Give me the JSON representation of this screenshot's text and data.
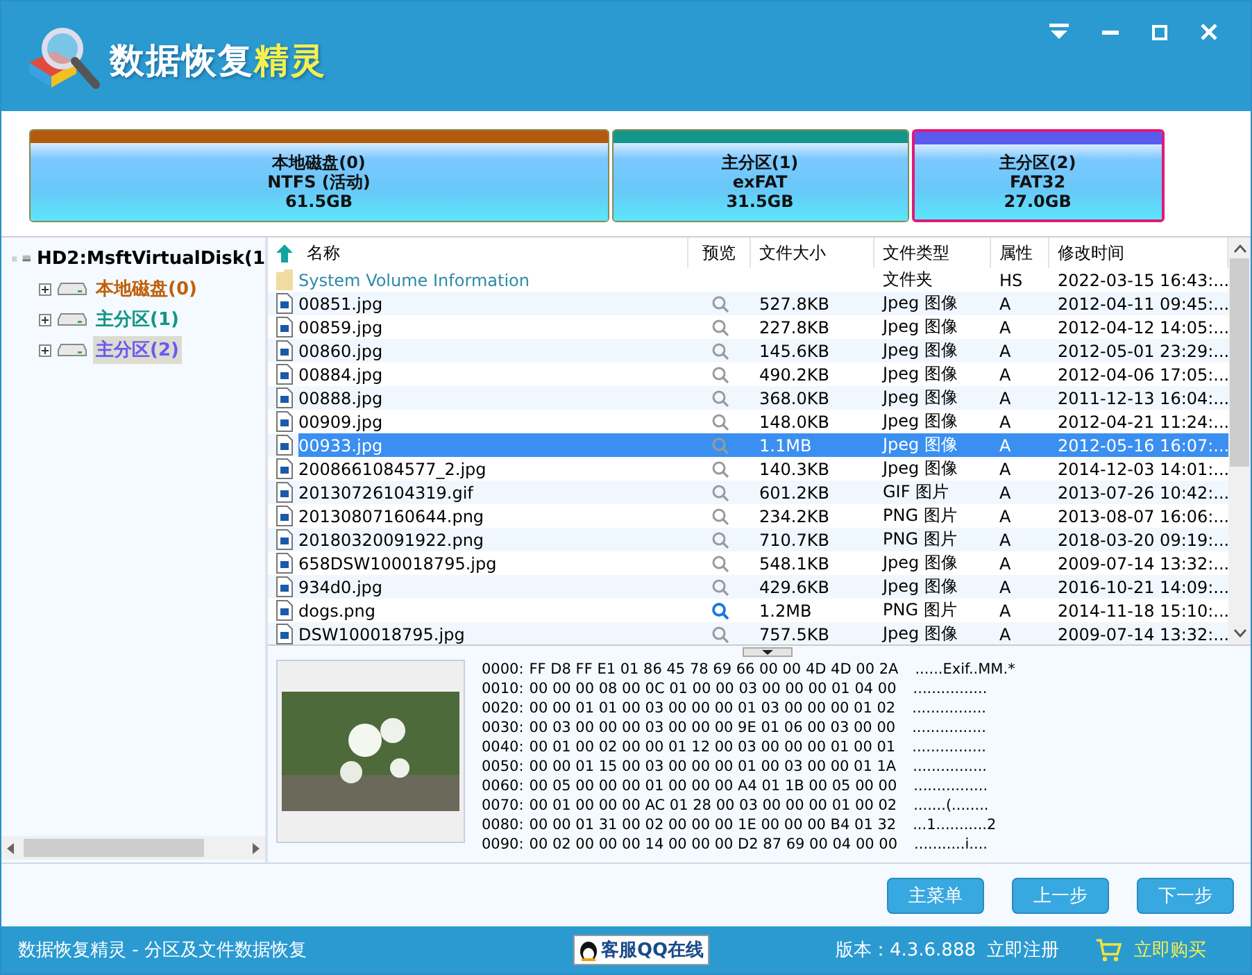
{
  "logo": {
    "text": "数据恢复",
    "accent": "精灵"
  },
  "partitions": [
    {
      "name": "本地磁盘(0)",
      "fs": "NTFS (活动)",
      "size": "61.5GB",
      "color": "#b35a0e",
      "selected": false
    },
    {
      "name": "主分区(1)",
      "fs": "exFAT",
      "size": "31.5GB",
      "color": "#13958a",
      "selected": false
    },
    {
      "name": "主分区(2)",
      "fs": "FAT32",
      "size": "27.0GB",
      "color": "#5a5af0",
      "selected": true
    }
  ],
  "tree": {
    "label": "HD2:MsftVirtualDisk(1",
    "expanded": true,
    "children": [
      {
        "label": "本地磁盘(0)",
        "color": "#c0600c",
        "expanded": false,
        "selected": false
      },
      {
        "label": "主分区(1)",
        "color": "#13958a",
        "expanded": false,
        "selected": false
      },
      {
        "label": "主分区(2)",
        "color": "#6a5af0",
        "expanded": false,
        "selected": true
      }
    ]
  },
  "table": {
    "columns": [
      "名称",
      "预览",
      "文件大小",
      "文件类型",
      "属性",
      "修改时间"
    ],
    "rows": [
      {
        "kind": "folder",
        "name": "System Volume Information",
        "preview_icon": false,
        "preview_hover": false,
        "size": "",
        "type": "文件夹",
        "attr": "HS",
        "time": "2022-03-15 16:43:...",
        "selected": false
      },
      {
        "kind": "image",
        "name": "00851.jpg",
        "preview_icon": true,
        "preview_hover": false,
        "size": "527.8KB",
        "type": "Jpeg 图像",
        "attr": "A",
        "time": "2012-04-11 09:45:...",
        "selected": false
      },
      {
        "kind": "image",
        "name": "00859.jpg",
        "preview_icon": true,
        "preview_hover": false,
        "size": "227.8KB",
        "type": "Jpeg 图像",
        "attr": "A",
        "time": "2012-04-12 14:05:...",
        "selected": false
      },
      {
        "kind": "image",
        "name": "00860.jpg",
        "preview_icon": true,
        "preview_hover": false,
        "size": "145.6KB",
        "type": "Jpeg 图像",
        "attr": "A",
        "time": "2012-05-01 23:29:...",
        "selected": false
      },
      {
        "kind": "image",
        "name": "00884.jpg",
        "preview_icon": true,
        "preview_hover": false,
        "size": "490.2KB",
        "type": "Jpeg 图像",
        "attr": "A",
        "time": "2012-04-06 17:05:...",
        "selected": false
      },
      {
        "kind": "image",
        "name": "00888.jpg",
        "preview_icon": true,
        "preview_hover": false,
        "size": "368.0KB",
        "type": "Jpeg 图像",
        "attr": "A",
        "time": "2011-12-13 16:04:...",
        "selected": false
      },
      {
        "kind": "image",
        "name": "00909.jpg",
        "preview_icon": true,
        "preview_hover": false,
        "size": "148.0KB",
        "type": "Jpeg 图像",
        "attr": "A",
        "time": "2012-04-21 11:24:...",
        "selected": false
      },
      {
        "kind": "image",
        "name": "00933.jpg",
        "preview_icon": true,
        "preview_hover": false,
        "size": "1.1MB",
        "type": "Jpeg 图像",
        "attr": "A",
        "time": "2012-05-16 16:07:...",
        "selected": true
      },
      {
        "kind": "image",
        "name": "2008661084577_2.jpg",
        "preview_icon": true,
        "preview_hover": false,
        "size": "140.3KB",
        "type": "Jpeg 图像",
        "attr": "A",
        "time": "2014-12-03 14:01:...",
        "selected": false
      },
      {
        "kind": "image",
        "name": "20130726104319.gif",
        "preview_icon": true,
        "preview_hover": false,
        "size": "601.2KB",
        "type": "GIF 图片",
        "attr": "A",
        "time": "2013-07-26 10:42:...",
        "selected": false
      },
      {
        "kind": "image",
        "name": "20130807160644.png",
        "preview_icon": true,
        "preview_hover": false,
        "size": "234.2KB",
        "type": "PNG 图片",
        "attr": "A",
        "time": "2013-08-07 16:06:...",
        "selected": false
      },
      {
        "kind": "image",
        "name": "20180320091922.png",
        "preview_icon": true,
        "preview_hover": false,
        "size": "710.7KB",
        "type": "PNG 图片",
        "attr": "A",
        "time": "2018-03-20 09:19:...",
        "selected": false
      },
      {
        "kind": "image",
        "name": "658DSW100018795.jpg",
        "preview_icon": true,
        "preview_hover": false,
        "size": "548.1KB",
        "type": "Jpeg 图像",
        "attr": "A",
        "time": "2009-07-14 13:32:...",
        "selected": false
      },
      {
        "kind": "image",
        "name": "934d0.jpg",
        "preview_icon": true,
        "preview_hover": false,
        "size": "429.6KB",
        "type": "Jpeg 图像",
        "attr": "A",
        "time": "2016-10-21 14:09:...",
        "selected": false
      },
      {
        "kind": "image",
        "name": "dogs.png",
        "preview_icon": true,
        "preview_hover": true,
        "size": "1.2MB",
        "type": "PNG 图片",
        "attr": "A",
        "time": "2014-11-18 15:10:...",
        "selected": false
      },
      {
        "kind": "image",
        "name": "DSW100018795.jpg",
        "preview_icon": true,
        "preview_hover": false,
        "size": "757.5KB",
        "type": "Jpeg 图像",
        "attr": "A",
        "time": "2009-07-14 13:32:...",
        "selected": false
      }
    ]
  },
  "hex_dump": [
    {
      "offset": "0000:",
      "bytes": "FF D8 FF E1 01 86 45 78 69 66 00 00 4D 4D 00 2A",
      "ascii": "......Exif..MM.*"
    },
    {
      "offset": "0010:",
      "bytes": "00 00 00 08 00 0C 01 00 00 03 00 00 00 01 04 00",
      "ascii": "................"
    },
    {
      "offset": "0020:",
      "bytes": "00 00 01 01 00 03 00 00 00 01 03 00 00 00 01 02",
      "ascii": "................"
    },
    {
      "offset": "0030:",
      "bytes": "00 03 00 00 00 03 00 00 00 9E 01 06 00 03 00 00",
      "ascii": "................"
    },
    {
      "offset": "0040:",
      "bytes": "00 01 00 02 00 00 01 12 00 03 00 00 00 01 00 01",
      "ascii": "................"
    },
    {
      "offset": "0050:",
      "bytes": "00 00 01 15 00 03 00 00 00 01 00 03 00 00 01 1A",
      "ascii": "................"
    },
    {
      "offset": "0060:",
      "bytes": "00 05 00 00 00 01 00 00 00 A4 01 1B 00 05 00 00",
      "ascii": "................"
    },
    {
      "offset": "0070:",
      "bytes": "00 01 00 00 00 AC 01 28 00 03 00 00 00 01 00 02",
      "ascii": ".......(........"
    },
    {
      "offset": "0080:",
      "bytes": "00 00 01 31 00 02 00 00 00 1E 00 00 00 B4 01 32",
      "ascii": "...1...........2"
    },
    {
      "offset": "0090:",
      "bytes": "00 02 00 00 00 14 00 00 00 D2 87 69 00 04 00 00",
      "ascii": "...........i...."
    }
  ],
  "buttons": [
    "主菜单",
    "上一步",
    "下一步"
  ],
  "status_bar": {
    "app": "数据恢复精灵 - 分区及文件数据恢复",
    "support": "客服QQ在线",
    "version": "版本：4.3.6.888",
    "register": "立即注册",
    "buy": "立即购买"
  }
}
